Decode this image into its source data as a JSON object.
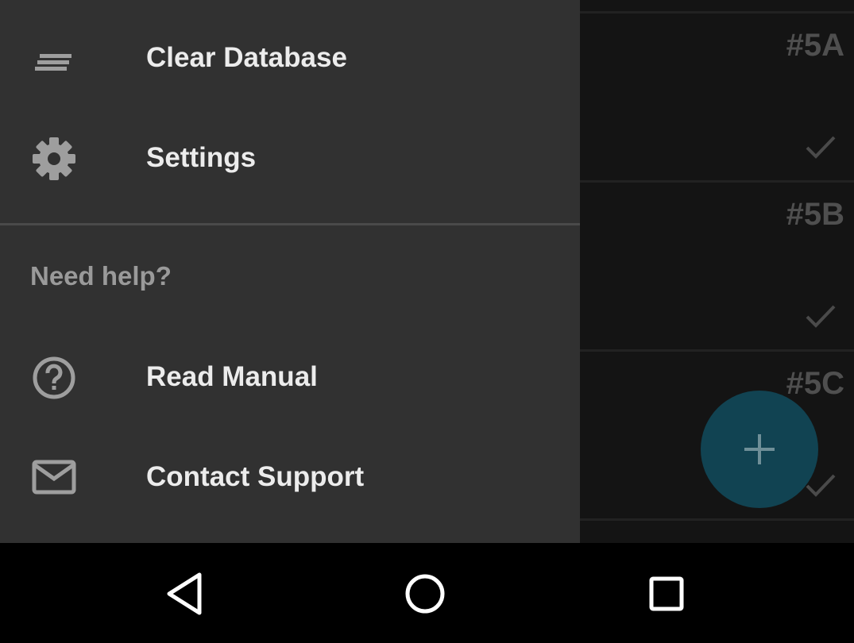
{
  "list": {
    "rows": [
      {
        "label": "#5A"
      },
      {
        "label": "#5B"
      },
      {
        "label": "#5C"
      }
    ]
  },
  "drawer": {
    "items": [
      {
        "label": "Clear Database",
        "icon": "clear-all-icon"
      },
      {
        "label": "Settings",
        "icon": "gear-icon"
      }
    ],
    "help_section": {
      "header": "Need help?",
      "items": [
        {
          "label": "Read Manual",
          "icon": "help-circle-icon"
        },
        {
          "label": "Contact Support",
          "icon": "mail-icon"
        }
      ]
    }
  },
  "fab": {
    "icon": "plus-icon",
    "color": "#114352"
  },
  "navbar": {
    "buttons": [
      {
        "icon": "back-triangle-icon"
      },
      {
        "icon": "home-circle-icon"
      },
      {
        "icon": "recents-square-icon"
      }
    ]
  }
}
